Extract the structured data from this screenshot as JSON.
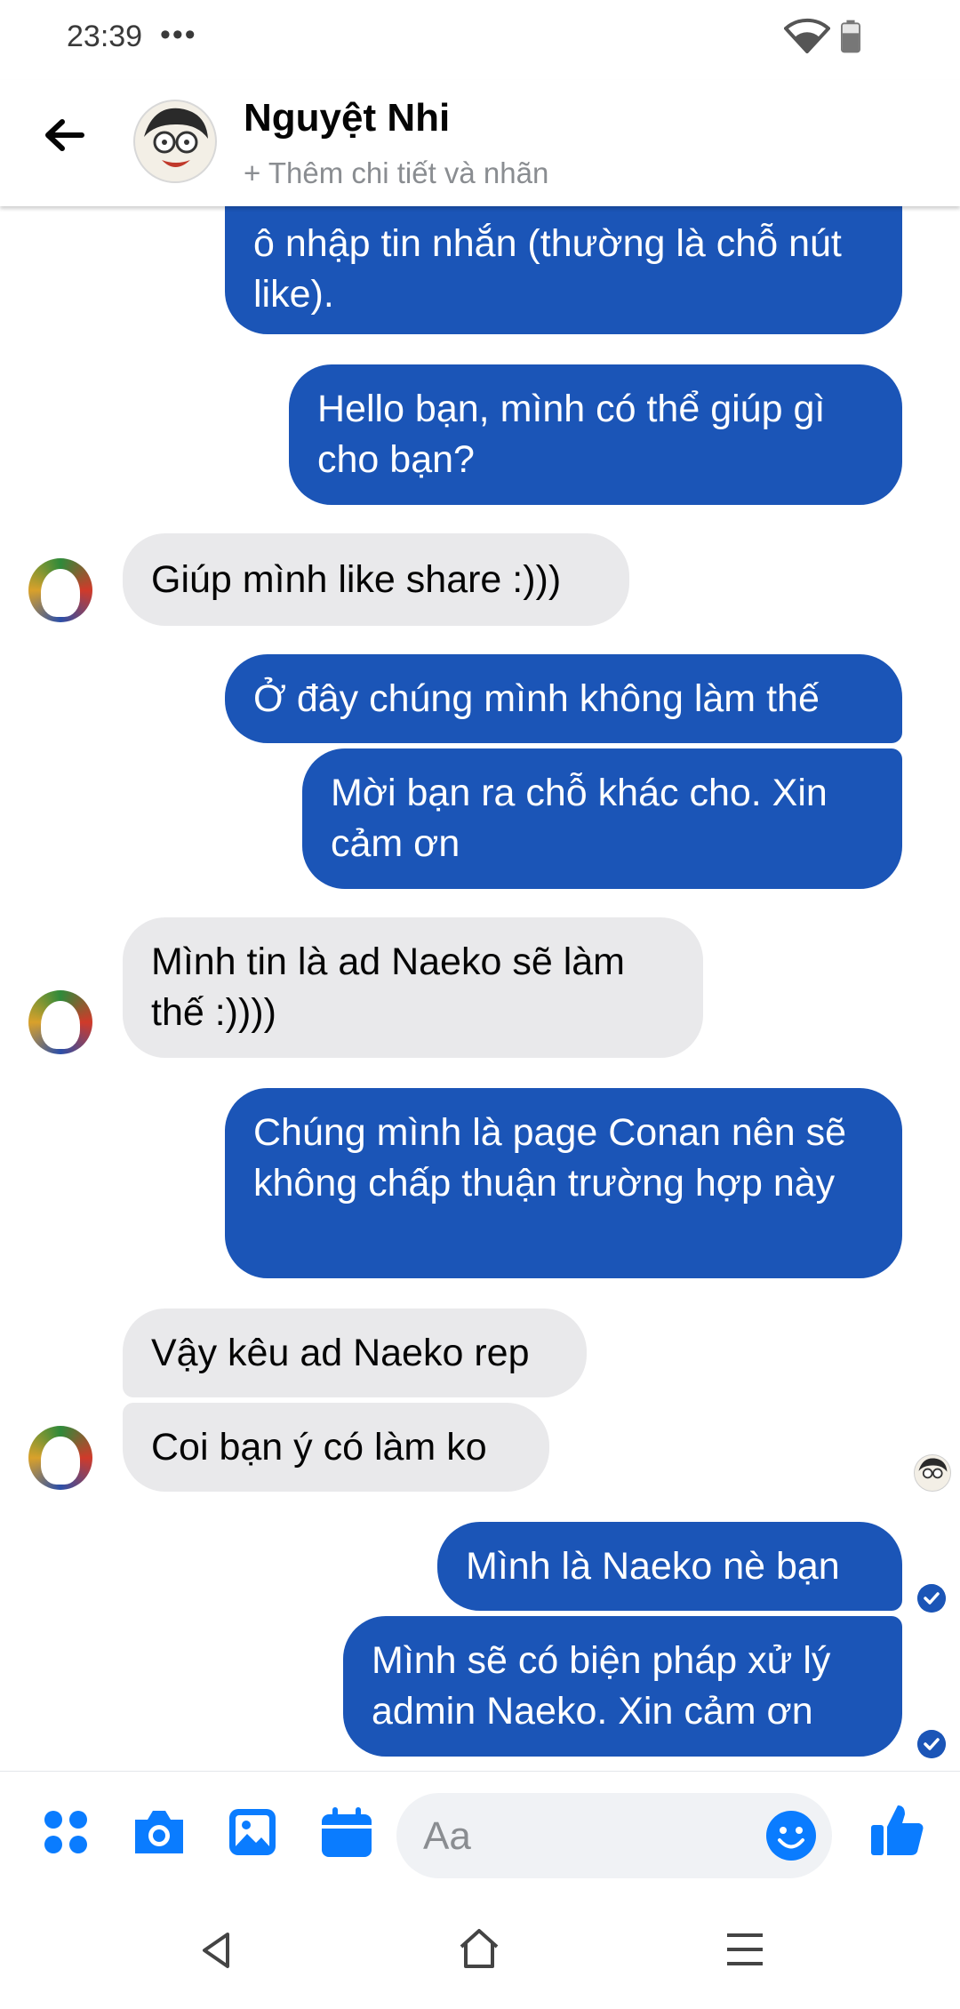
{
  "status": {
    "time": "23:39",
    "dots": "•••"
  },
  "header": {
    "name": "Nguyệt Nhi",
    "subtitle": "+ Thêm chi tiết và nhãn"
  },
  "messages": [
    {
      "from": "me",
      "text": "ô nhập tin nhắn (thường là chỗ nút like)."
    },
    {
      "from": "me",
      "text": "Hello bạn, mình có thể giúp gì cho bạn?"
    },
    {
      "from": "them",
      "text": "Giúp mình like share :)))"
    },
    {
      "from": "me",
      "text": "Ở đây chúng mình không làm thế"
    },
    {
      "from": "me",
      "text": "Mời bạn ra chỗ khác cho. Xin cảm ơn"
    },
    {
      "from": "them",
      "text": "Mình tin là ad Naeko sẽ làm thế :))))"
    },
    {
      "from": "me",
      "text": "Chúng mình là page Conan nên sẽ không chấp thuận trường hợp này"
    },
    {
      "from": "them",
      "text": "Vậy kêu ad Naeko rep"
    },
    {
      "from": "them",
      "text": "Coi bạn ý có làm ko"
    },
    {
      "from": "me",
      "text": "Mình là Naeko nè bạn"
    },
    {
      "from": "me",
      "text": "Mình sẽ có biện pháp xử lý admin Naeko. Xin cảm ơn"
    }
  ],
  "composer": {
    "placeholder": "Aa"
  },
  "colors": {
    "outgoing": "#1b55b7",
    "incoming": "#e9e9eb",
    "accent": "#0a7cff"
  },
  "icons": [
    "back-arrow-icon",
    "menu-grid-icon",
    "camera-icon",
    "image-icon",
    "calendar-icon",
    "emoji-icon",
    "like-icon",
    "nav-back-icon",
    "nav-home-icon",
    "nav-menu-icon"
  ]
}
